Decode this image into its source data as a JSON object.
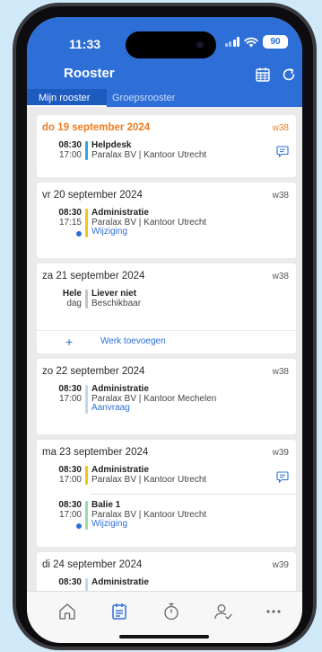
{
  "status_bar": {
    "time": "11:33",
    "battery": "90"
  },
  "header": {
    "title": "Rooster",
    "calendar_icon": "calendar-grid-icon",
    "refresh_icon": "refresh-icon"
  },
  "tabs": [
    {
      "label": "Mijn rooster",
      "active": true
    },
    {
      "label": "Groepsrooster",
      "active": false
    }
  ],
  "days": [
    {
      "date": "do 19 september 2024",
      "week": "w38",
      "today": true,
      "shifts": [
        {
          "start": "08:30",
          "end": "17:00",
          "name": "Helpdesk",
          "location": "Paralax BV | Kantoor Utrecht",
          "status": "",
          "color": "#29a8e0",
          "comment": true
        }
      ]
    },
    {
      "date": "vr 20 september 2024",
      "week": "w38",
      "today": false,
      "shifts": [
        {
          "start": "08:30",
          "end": "17:15",
          "name": "Administratie",
          "location": "Paralax BV | Kantoor Utrecht",
          "status": "Wijziging",
          "color": "#f2c516",
          "comment": false,
          "marker": true
        }
      ]
    },
    {
      "date": "za 21 september 2024",
      "week": "w38",
      "today": false,
      "shifts": [
        {
          "start": "Hele",
          "end": "dag",
          "name": "Liever niet",
          "location": "Beschikbaar",
          "status": "",
          "color": "#c4c4c4",
          "comment": false
        }
      ],
      "add_label": "Werk toevoegen"
    },
    {
      "date": "zo 22 september 2024",
      "week": "w38",
      "today": false,
      "shifts": [
        {
          "start": "08:30",
          "end": "17:00",
          "name": "Administratie",
          "location": "Paralax BV | Kantoor Mechelen",
          "status": "Aanvraag",
          "color": "#bdd8f0",
          "comment": false
        }
      ]
    },
    {
      "date": "ma 23 september 2024",
      "week": "w39",
      "today": false,
      "shifts": [
        {
          "start": "08:30",
          "end": "17:00",
          "name": "Administratie",
          "location": "Paralax BV | Kantoor Utrecht",
          "status": "",
          "color": "#f2c516",
          "comment": true
        },
        {
          "start": "08:30",
          "end": "17:00",
          "name": "Balie 1",
          "location": "Paralax BV | Kantoor Utrecht",
          "status": "Wijziging",
          "color": "#9bdba3",
          "comment": false,
          "marker": true
        }
      ]
    },
    {
      "date": "di 24 september 2024",
      "week": "w39",
      "today": false,
      "shifts": [
        {
          "start": "08:30",
          "end": "",
          "name": "Administratie",
          "location": "",
          "status": "",
          "color": "#bdd8f0",
          "comment": false
        }
      ]
    }
  ],
  "bottom_nav": [
    {
      "icon": "home-icon",
      "active": false
    },
    {
      "icon": "schedule-icon",
      "active": true
    },
    {
      "icon": "stopwatch-icon",
      "active": false
    },
    {
      "icon": "user-check-icon",
      "active": false
    },
    {
      "icon": "more-icon",
      "active": false
    }
  ],
  "colors": {
    "brand": "#2e6fd7",
    "today": "#ef7c20",
    "status": "#2e6fd7"
  }
}
